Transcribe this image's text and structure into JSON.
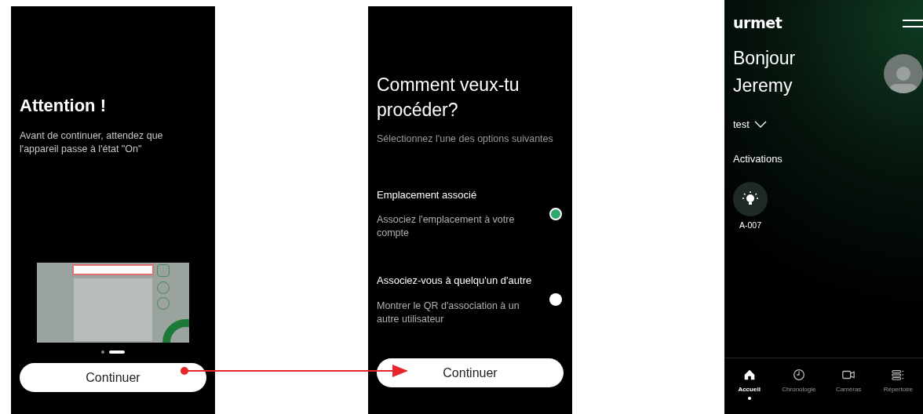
{
  "screens": [
    {
      "kind": "notice",
      "title": "Attention !",
      "message": "Avant de continuer, attendez que l'appareil passe à l'état \"On\"",
      "pager": [
        {
          "selected": false
        },
        {
          "selected": true
        }
      ],
      "button": "Continuer"
    },
    {
      "kind": "choice",
      "title": "Comment veux-tu procéder?",
      "subtitle": "Sélectionnez l'une des options suivantes",
      "options": [
        {
          "title": "Emplacement associé",
          "description": "Associez l'emplacement à votre compte",
          "selected": true
        },
        {
          "title": "Associez-vous à quelqu'un d'autre",
          "description": "Montrer le QR d'association à un autre utilisateur",
          "selected": false
        }
      ],
      "button": "Continuer"
    },
    {
      "kind": "home",
      "logo": "urmet",
      "greeting": "Bonjour Jeremy",
      "site": "test",
      "section": "Activations",
      "activations": [
        {
          "label": "A-007"
        }
      ],
      "nav": [
        {
          "label": "Accueil",
          "kind": "home",
          "selected": true
        },
        {
          "label": "Chronologie",
          "kind": "timeline",
          "selected": false
        },
        {
          "label": "Caméras",
          "kind": "cameras",
          "selected": false
        },
        {
          "label": "Répertoire",
          "kind": "directory",
          "selected": false
        }
      ]
    }
  ]
}
